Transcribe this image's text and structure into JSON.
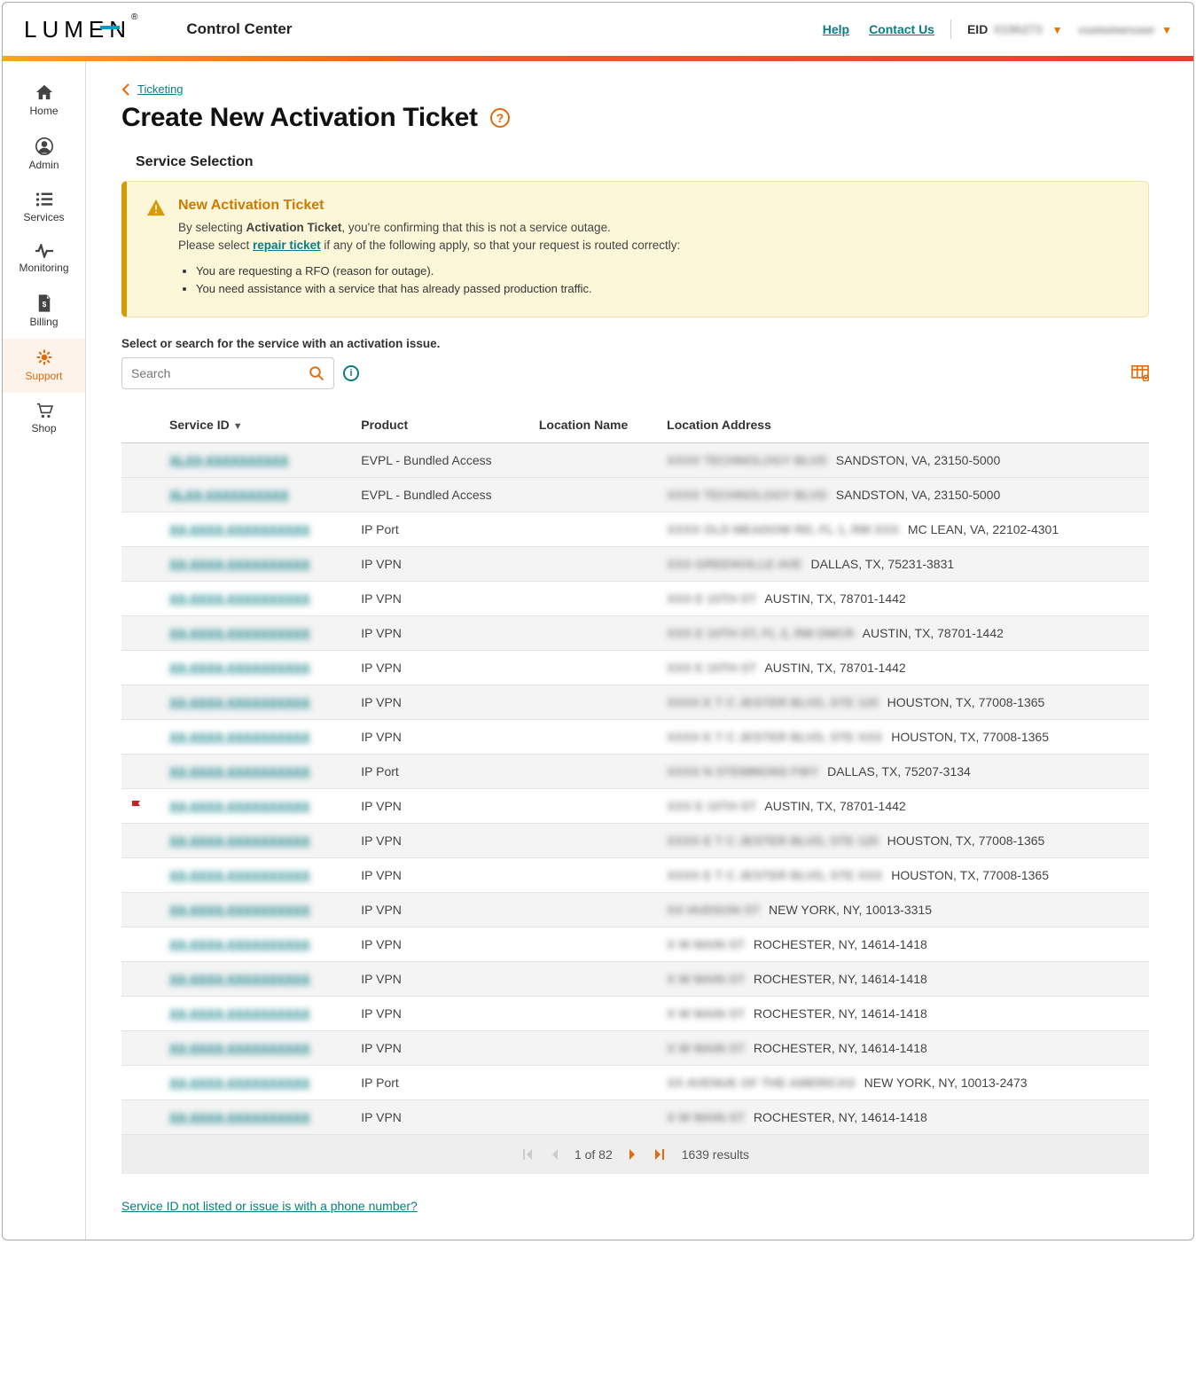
{
  "brand": {
    "name": "LUMEN",
    "product": "Control Center"
  },
  "topbar": {
    "help": "Help",
    "contact": "Contact Us",
    "eid_label": "EID",
    "eid_value": "0196273",
    "username": "customeruser"
  },
  "sidenav": [
    {
      "key": "home",
      "label": "Home"
    },
    {
      "key": "admin",
      "label": "Admin"
    },
    {
      "key": "services",
      "label": "Services"
    },
    {
      "key": "monitoring",
      "label": "Monitoring"
    },
    {
      "key": "billing",
      "label": "Billing"
    },
    {
      "key": "support",
      "label": "Support",
      "active": true
    },
    {
      "key": "shop",
      "label": "Shop"
    }
  ],
  "breadcrumb": {
    "parent": "Ticketing"
  },
  "page_title": "Create New Activation Ticket",
  "section_title": "Service Selection",
  "alert": {
    "heading": "New Activation Ticket",
    "line1_a": "By selecting ",
    "line1_b": "Activation Ticket",
    "line1_c": ", you're confirming that this is not a service outage.",
    "line2_a": "Please select ",
    "line2_link": "repair ticket",
    "line2_b": " if any of the following apply, so that your request is routed correctly:",
    "bullets": [
      "You are requesting a RFO (reason for outage).",
      "You need assistance with a service that has already passed production traffic."
    ]
  },
  "search": {
    "instruction": "Select or search for the service with an activation issue.",
    "placeholder": "Search"
  },
  "columns": {
    "service_id": "Service ID",
    "product": "Product",
    "location_name": "Location Name",
    "location_address": "Location Address"
  },
  "rows": [
    {
      "sid": "XLXX-XXXXXXXXXX",
      "product": "EVPL - Bundled Access",
      "addr_blur": "XXXX TECHNOLOGY BLVD",
      "addr": "SANDSTON, VA, 23150-5000",
      "alt": true
    },
    {
      "sid": "XLXX-XXXXXXXXXX",
      "product": "EVPL - Bundled Access",
      "addr_blur": "XXXX TECHNOLOGY BLVD",
      "addr": "SANDSTON, VA, 23150-5000",
      "alt": true
    },
    {
      "sid": "XX-XXXX-XXXXXXXXXX",
      "product": "IP Port",
      "addr_blur": "XXXX OLD MEADOW RD, FL 1, RM XXX",
      "addr": "MC LEAN, VA, 22102-4301"
    },
    {
      "sid": "XX-XXXX-XXXXXXXXXX",
      "product": "IP VPN",
      "addr_blur": "XXX GREENVILLE AVE",
      "addr": "DALLAS, TX, 75231-3831",
      "alt": true
    },
    {
      "sid": "XX-XXXX-XXXXXXXXXX",
      "product": "IP VPN",
      "addr_blur": "XXX E 10TH ST",
      "addr": "AUSTIN, TX, 78701-1442"
    },
    {
      "sid": "XX-XXXX-XXXXXXXXXX",
      "product": "IP VPN",
      "addr_blur": "XXX E 10TH ST, FL 2, RM DMCR",
      "addr": "AUSTIN, TX, 78701-1442",
      "alt": true
    },
    {
      "sid": "XX-XXXX-XXXXXXXXXX",
      "product": "IP VPN",
      "addr_blur": "XXX E 10TH ST",
      "addr": "AUSTIN, TX, 78701-1442"
    },
    {
      "sid": "XX-XXXX-XXXXXXXXXX",
      "product": "IP VPN",
      "addr_blur": "XXXX E T C JESTER BLVD, STE 120",
      "addr": "HOUSTON, TX, 77008-1365",
      "alt": true
    },
    {
      "sid": "XX-XXXX-XXXXXXXXXX",
      "product": "IP VPN",
      "addr_blur": "XXXX E T C JESTER BLVD, STE XXX",
      "addr": "HOUSTON, TX, 77008-1365"
    },
    {
      "sid": "XX-XXXX-XXXXXXXXXX",
      "product": "IP Port",
      "addr_blur": "XXXX N STEMMONS FWY",
      "addr": "DALLAS, TX, 75207-3134",
      "alt": true
    },
    {
      "sid": "XX-XXXX-XXXXXXXXXX",
      "product": "IP VPN",
      "addr_blur": "XXX E 10TH ST",
      "addr": "AUSTIN, TX, 78701-1442",
      "flag": true
    },
    {
      "sid": "XX-XXXX-XXXXXXXXXX",
      "product": "IP VPN",
      "addr_blur": "XXXX E T C JESTER BLVD, STE 120",
      "addr": "HOUSTON, TX, 77008-1365",
      "alt": true
    },
    {
      "sid": "XX-XXXX-XXXXXXXXXX",
      "product": "IP VPN",
      "addr_blur": "XXXX E T C JESTER BLVD, STE XXX",
      "addr": "HOUSTON, TX, 77008-1365"
    },
    {
      "sid": "XX-XXXX-XXXXXXXXXX",
      "product": "IP VPN",
      "addr_blur": "XX HUDSON ST",
      "addr": "NEW YORK, NY, 10013-3315",
      "alt": true
    },
    {
      "sid": "XX-XXXX-XXXXXXXXXX",
      "product": "IP VPN",
      "addr_blur": "X W MAIN ST",
      "addr": "ROCHESTER, NY, 14614-1418"
    },
    {
      "sid": "XX-XXXX-XXXXXXXXXX",
      "product": "IP VPN",
      "addr_blur": "X W MAIN ST",
      "addr": "ROCHESTER, NY, 14614-1418",
      "alt": true
    },
    {
      "sid": "XX-XXXX-XXXXXXXXXX",
      "product": "IP VPN",
      "addr_blur": "X W MAIN ST",
      "addr": "ROCHESTER, NY, 14614-1418"
    },
    {
      "sid": "XX-XXXX-XXXXXXXXXX",
      "product": "IP VPN",
      "addr_blur": "X W MAIN ST",
      "addr": "ROCHESTER, NY, 14614-1418",
      "alt": true
    },
    {
      "sid": "XX-XXXX-XXXXXXXXXX",
      "product": "IP Port",
      "addr_blur": "XX AVENUE OF THE AMERICAS",
      "addr": "NEW YORK, NY, 10013-2473"
    },
    {
      "sid": "XX-XXXX-XXXXXXXXXX",
      "product": "IP VPN",
      "addr_blur": "X W MAIN ST",
      "addr": "ROCHESTER, NY, 14614-1418",
      "alt": true
    }
  ],
  "pager": {
    "page_text": "1 of 82",
    "results_text": "1639 results"
  },
  "footer_link": "Service ID not listed or issue is with a phone number?"
}
